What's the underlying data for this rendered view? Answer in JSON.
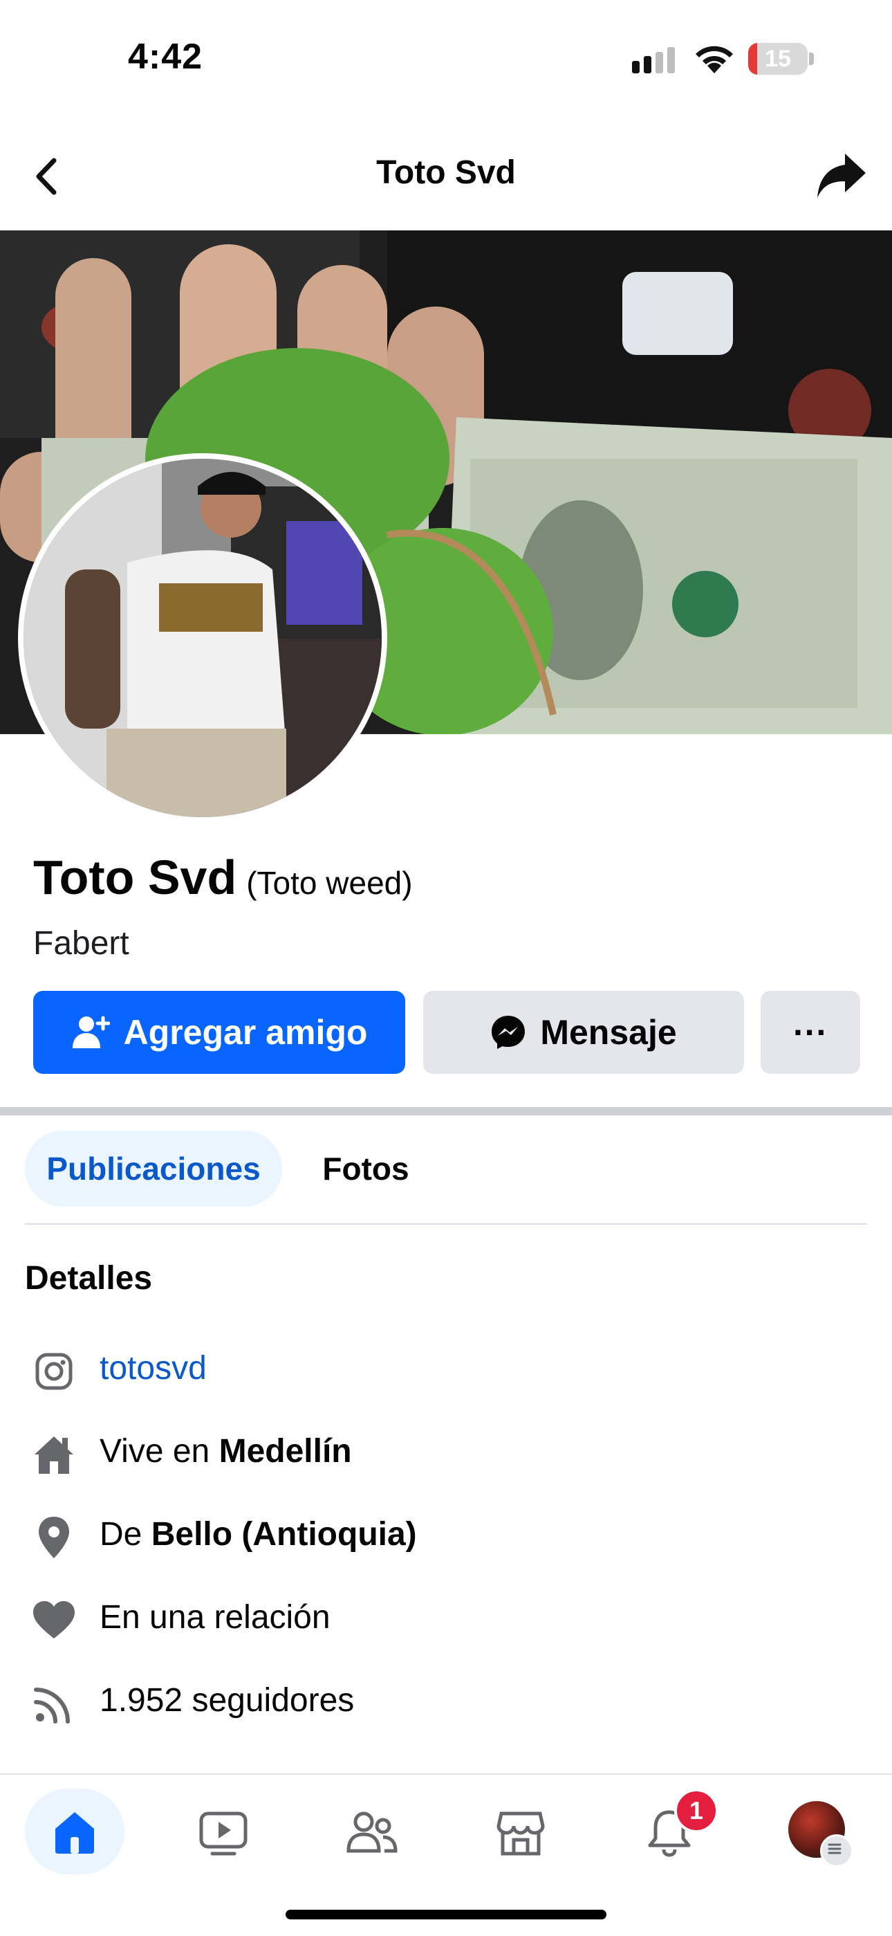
{
  "status_bar": {
    "time": "4:42",
    "battery": "15",
    "battery_level": 0.15
  },
  "header": {
    "title": "Toto Svd",
    "back_icon": "chevron-left-icon",
    "share_icon": "share-arrow-icon"
  },
  "profile": {
    "name": "Toto Svd",
    "alias": "(Toto weed)",
    "subtitle": "Fabert"
  },
  "actions": {
    "add_friend": "Agregar amigo",
    "message": "Mensaje",
    "more": "···"
  },
  "tabs": [
    {
      "label": "Publicaciones",
      "active": true
    },
    {
      "label": "Fotos",
      "active": false
    }
  ],
  "details": {
    "title": "Detalles",
    "instagram": "totosvd",
    "lives_prefix": "Vive en ",
    "lives_place": "Medellín",
    "from_prefix": "De ",
    "from_place": "Bello (Antioquia)",
    "relationship": "En una relación",
    "followers": "1.952 seguidores"
  },
  "bottom_nav": {
    "notifications_badge": "1",
    "items": [
      "home-icon",
      "video-icon",
      "friends-icon",
      "marketplace-icon",
      "notifications-icon",
      "profile-menu"
    ]
  },
  "colors": {
    "accent": "#0866ff",
    "link": "#0a58ca",
    "badge": "#e41e3f"
  }
}
